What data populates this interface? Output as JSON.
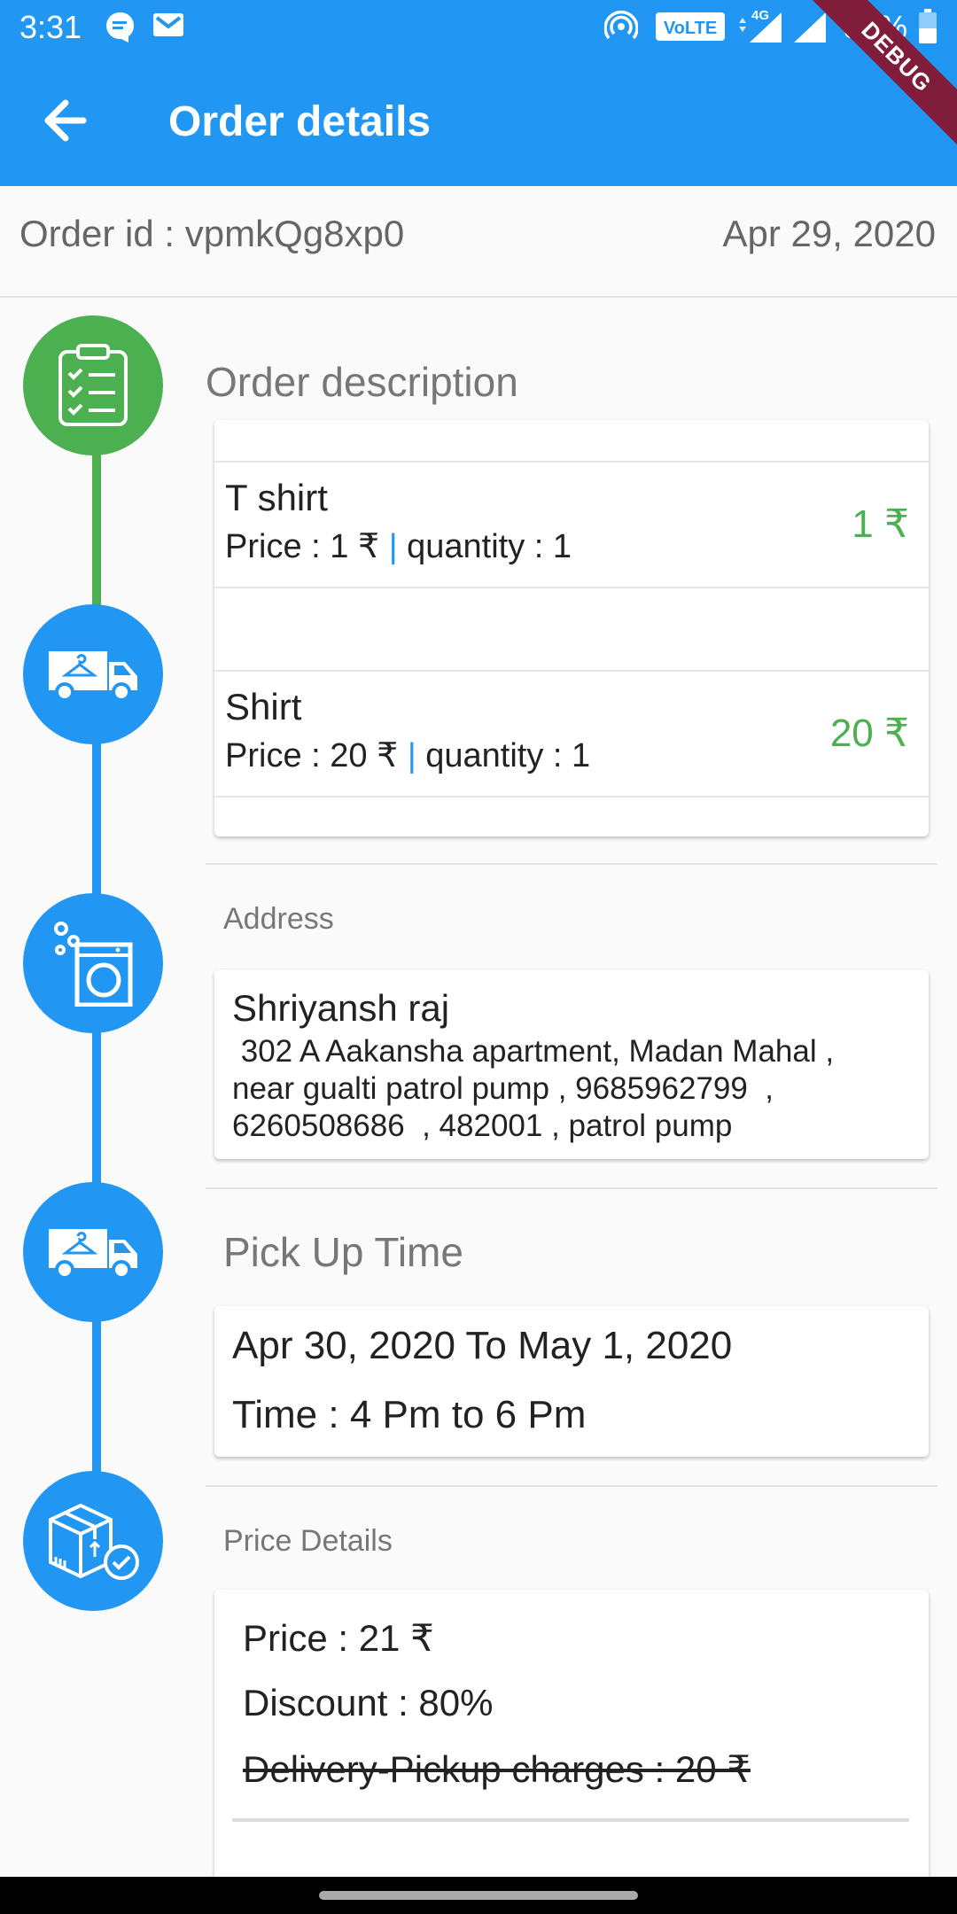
{
  "status_bar": {
    "time": "3:31",
    "volte": "VoLTE",
    "network": "4G",
    "battery": "38%"
  },
  "app_bar": {
    "title": "Order details",
    "debug_label": "DEBUG",
    "color": "#2196f3"
  },
  "order": {
    "id_label": "Order id : vpmkQg8xp0",
    "date": "Apr 29, 2020"
  },
  "timeline": {
    "icons": [
      "checklist-icon",
      "delivery-van-icon",
      "washing-machine-icon",
      "delivery-van-icon",
      "package-check-icon"
    ],
    "colors": {
      "done": "#4caf50",
      "pending": "#2196f3"
    }
  },
  "order_description": {
    "title": "Order description",
    "items": [
      {
        "name": "T shirt",
        "price_label": "Price : 1 ₹",
        "pipe": "|",
        "quantity_label": "quantity : 1",
        "total": "1 ₹"
      },
      {
        "name": "Shirt",
        "price_label": "Price : 20 ₹",
        "pipe": "|",
        "quantity_label": "quantity : 1",
        "total": "20 ₹"
      }
    ]
  },
  "address": {
    "title": "Address",
    "name": "Shriyansh raj",
    "line1": " 302 A Aakansha apartment, Madan Mahal ,",
    "line2": "near gualti patrol pump , 9685962799  ,",
    "line3": "6260508686  , 482001 , patrol pump"
  },
  "pickup": {
    "title": "Pick Up Time",
    "date_range": "Apr 30, 2020 To May 1, 2020",
    "time": "Time : 4 Pm to 6 Pm"
  },
  "price_details": {
    "title": "Price Details",
    "price": "Price : 21 ₹",
    "discount": "Discount : 80%",
    "delivery_charges": "Delivery-Pickup charges : 20 ₹"
  }
}
